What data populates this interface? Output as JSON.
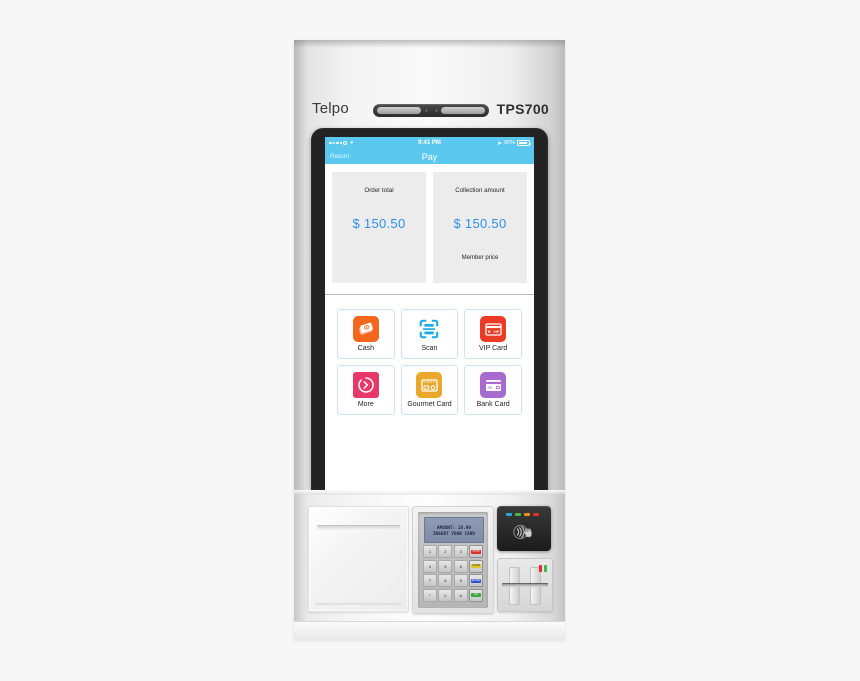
{
  "device": {
    "brand": "Telpo",
    "model": "TPS700"
  },
  "screen": {
    "status_bar": {
      "carrier_dots": 5,
      "wifi_icon": "wifi-icon",
      "time": "9:41 PM",
      "location_icon": "location-arrow-icon",
      "battery_percent": "90%"
    },
    "nav_bar": {
      "back_label": "Return",
      "title": "Pay"
    },
    "amounts": [
      {
        "label": "Order total",
        "value": "$ 150.50",
        "sub": ""
      },
      {
        "label": "Collection amount",
        "value": "$ 150.50",
        "sub": "Member price"
      }
    ],
    "payment_methods": [
      {
        "label": "Cash",
        "icon": "cash-banknotes-icon",
        "color": "#f4671c"
      },
      {
        "label": "Scan",
        "icon": "scan-qr-icon",
        "color": "#19a9e6"
      },
      {
        "label": "VIP Card",
        "icon": "vip-card-icon",
        "color": "#ec3b24"
      },
      {
        "label": "More",
        "icon": "more-arrow-icon",
        "color": "#e8386a"
      },
      {
        "label": "Gourmet Card",
        "icon": "gourmet-card-icon",
        "color": "#e9a72c"
      },
      {
        "label": "Bank Card",
        "icon": "bank-card-icon",
        "color": "#a76bd0"
      }
    ],
    "accent_color": "#5bc8f0",
    "amount_color": "#2f8fe8"
  },
  "hardware": {
    "printer": {
      "name": "Receipt printer door"
    },
    "pinpad": {
      "lcd_lines": [
        "AMOUNT: 18.99",
        "INSERT YOUR CARD"
      ],
      "keys": [
        "1",
        "2",
        "3",
        "STOP",
        "4",
        "5",
        "6",
        "CORR",
        "7",
        "8",
        "9",
        "ENTER",
        "*",
        "0",
        "#",
        "OK"
      ],
      "function_colors": [
        "#d7332c",
        "#dfc82b",
        "#2f55c8",
        "#3fa93f"
      ]
    },
    "nfc_reader": {
      "glyph": "contactless-hand-icon",
      "led_colors": [
        "#27a8e0",
        "#45b849",
        "#ef8c1f",
        "#e03027"
      ]
    },
    "card_reader": {
      "led_colors": [
        "#e03027",
        "#45b849"
      ]
    }
  }
}
